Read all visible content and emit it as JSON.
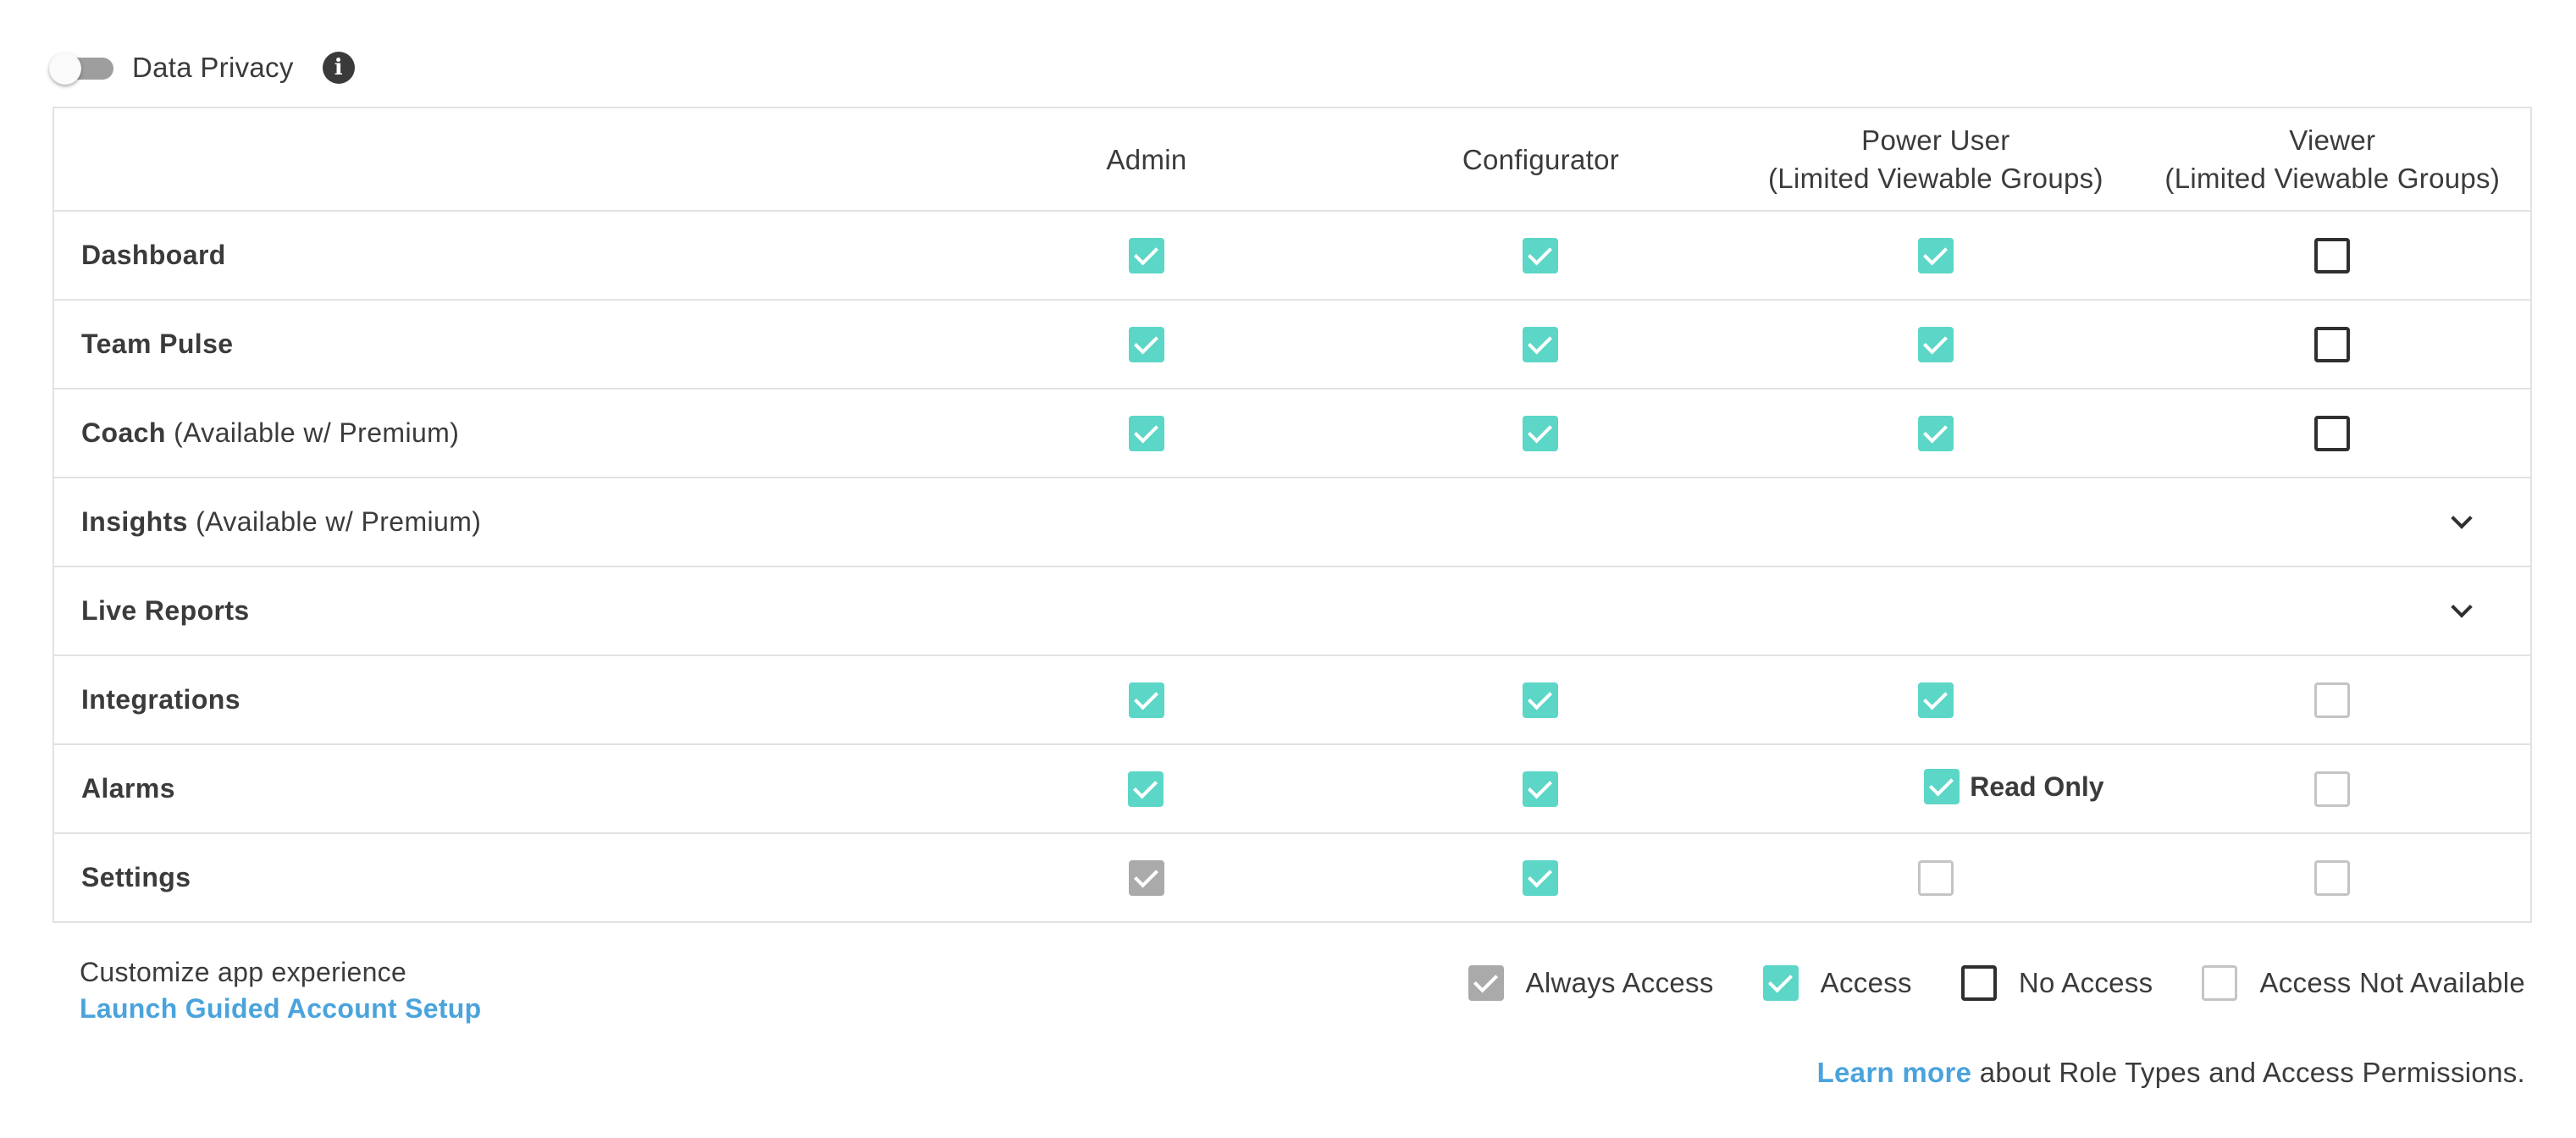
{
  "privacy": {
    "label": "Data Privacy",
    "enabled": false
  },
  "columns": [
    {
      "line1": "Admin",
      "line2": ""
    },
    {
      "line1": "Configurator",
      "line2": ""
    },
    {
      "line1": "Power User",
      "line2": "(Limited Viewable Groups)"
    },
    {
      "line1": "Viewer",
      "line2": "(Limited Viewable Groups)"
    }
  ],
  "rows": [
    {
      "name": "Dashboard",
      "suffix": "",
      "cells": [
        "access",
        "access",
        "access",
        "none"
      ]
    },
    {
      "name": "Team Pulse",
      "suffix": "",
      "cells": [
        "access",
        "access",
        "access",
        "none"
      ]
    },
    {
      "name": "Coach",
      "suffix": " (Available w/ Premium)",
      "cells": [
        "access",
        "access",
        "access",
        "none"
      ]
    },
    {
      "name": "Insights",
      "suffix": " (Available w/ Premium)",
      "expandable": true
    },
    {
      "name": "Live Reports",
      "suffix": "",
      "expandable": true
    },
    {
      "name": "Integrations",
      "suffix": "",
      "cells": [
        "access",
        "access",
        "access",
        "na"
      ]
    },
    {
      "name": "Alarms",
      "suffix": "",
      "cells": [
        "access",
        "access",
        "access",
        "na"
      ],
      "power_user_note": "Read Only"
    },
    {
      "name": "Settings",
      "suffix": "",
      "cells": [
        "always",
        "access",
        "na",
        "na"
      ]
    }
  ],
  "footer": {
    "customize": "Customize app experience",
    "launch": "Launch Guided Account Setup",
    "learn_link": "Learn more",
    "learn_rest": " about Role Types and Access Permissions."
  },
  "legend": [
    {
      "type": "always",
      "label": "Always Access"
    },
    {
      "type": "access",
      "label": "Access"
    },
    {
      "type": "none",
      "label": "No Access"
    },
    {
      "type": "na",
      "label": "Access Not Available"
    }
  ],
  "colors": {
    "access": "#5cd6c7",
    "always": "#aaaaaa",
    "link": "#4aa3dc",
    "border": "#e2e2e2"
  }
}
